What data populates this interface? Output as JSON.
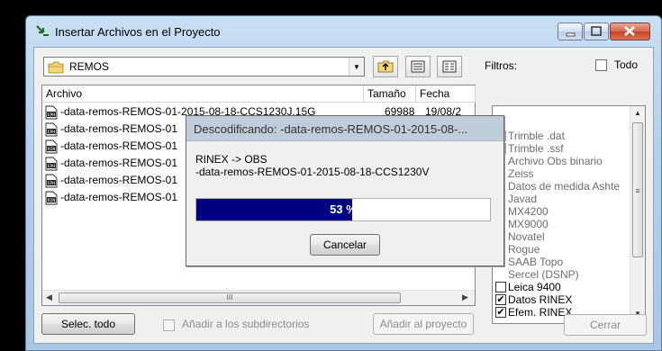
{
  "window": {
    "title": "Insertar Archivos en el Proyecto"
  },
  "toolbar": {
    "folder": "REMOS",
    "filters_label": "Filtros:",
    "todo_label": "Todo"
  },
  "file_list": {
    "columns": [
      "Archivo",
      "Tamaño",
      "Fecha"
    ],
    "rows": [
      {
        "icon": "EPH",
        "name": "-data-remos-REMOS-01-2015-08-18-CCS1230J.15G",
        "size": "69988",
        "date": "19/08/2"
      },
      {
        "icon": "EPH",
        "name": "-data-remos-REMOS-01",
        "size": "",
        "date": ""
      },
      {
        "icon": "RIN",
        "name": "-data-remos-REMOS-01",
        "size": "",
        "date": ""
      },
      {
        "icon": "EPH",
        "name": "-data-remos-REMOS-01",
        "size": "",
        "date": ""
      },
      {
        "icon": "EPH",
        "name": "-data-remos-REMOS-01",
        "size": "",
        "date": ""
      },
      {
        "icon": "RIN",
        "name": "-data-remos-REMOS-01",
        "size": "",
        "date": ""
      }
    ],
    "scrollbar_grip": "III"
  },
  "filters": [
    {
      "label": "Trimble .dat",
      "checked": true,
      "enabled": false
    },
    {
      "label": "Trimble .ssf",
      "checked": true,
      "enabled": false
    },
    {
      "label": "Archivo Obs binario",
      "checked": false,
      "enabled": false
    },
    {
      "label": "Zeiss",
      "checked": false,
      "enabled": false
    },
    {
      "label": "Datos de medida Ashte",
      "checked": false,
      "enabled": false
    },
    {
      "label": "Javad",
      "checked": false,
      "enabled": false
    },
    {
      "label": "MX4200",
      "checked": false,
      "enabled": false
    },
    {
      "label": "MX9000",
      "checked": false,
      "enabled": false
    },
    {
      "label": "Novatel",
      "checked": false,
      "enabled": false
    },
    {
      "label": "Rogue",
      "checked": false,
      "enabled": false
    },
    {
      "label": "SAAB Topo",
      "checked": false,
      "enabled": false
    },
    {
      "label": "Sercel (DSNP)",
      "checked": false,
      "enabled": false
    },
    {
      "label": "Leica 9400",
      "checked": false,
      "enabled": true
    },
    {
      "label": "Datos RINEX",
      "checked": true,
      "enabled": true
    },
    {
      "label": "Efem. RINEX",
      "checked": true,
      "enabled": true
    }
  ],
  "buttons": {
    "select_all": "Selec. todo",
    "subdirs": "Añadir a los subdirectorios",
    "add_to_project": "Añadir al proyecto",
    "close": "Cerrar"
  },
  "dialog": {
    "title": "Descodificando: -data-remos-REMOS-01-2015-08-...",
    "line1": "RINEX -> OBS",
    "line2": "-data-remos-REMOS-01-2015-08-18-CCS1230V",
    "progress_percent": 53,
    "progress_label": "53 %",
    "cancel_label": "Cancelar"
  },
  "colors": {
    "progress_fill": "#000080",
    "title_gradient_top": "#c9dff2",
    "close_button": "#c6412a"
  }
}
